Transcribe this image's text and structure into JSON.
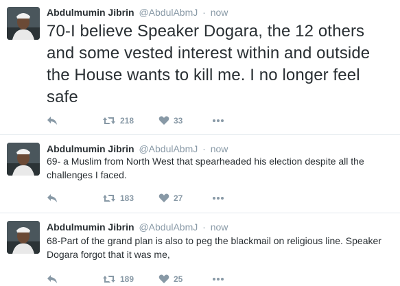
{
  "tweets": [
    {
      "author": "Abdulmumin Jibrin",
      "handle": "@AbdulAbmJ",
      "time": "now",
      "text": "70-I believe Speaker Dogara, the 12 others and some vested interest within and outside the House wants to kill me. I no longer feel safe",
      "retweets": "218",
      "likes": "33"
    },
    {
      "author": "Abdulmumin Jibrin",
      "handle": "@AbdulAbmJ",
      "time": "now",
      "text": "69- a Muslim from North West that spearheaded his election despite all the challenges I faced.",
      "retweets": "183",
      "likes": "27"
    },
    {
      "author": "Abdulmumin Jibrin",
      "handle": "@AbdulAbmJ",
      "time": "now",
      "text": "68-Part of the grand plan is also to peg the blackmail on religious line. Speaker Dogara forgot that it was me,",
      "retweets": "189",
      "likes": "25"
    }
  ],
  "separator": "·",
  "icons": {
    "reply": "reply-icon",
    "retweet": "retweet-icon",
    "like": "heart-icon",
    "more": "more-icon"
  },
  "colors": {
    "name": "#292f33",
    "meta": "#8899a6",
    "divider": "#e1e8ed"
  }
}
